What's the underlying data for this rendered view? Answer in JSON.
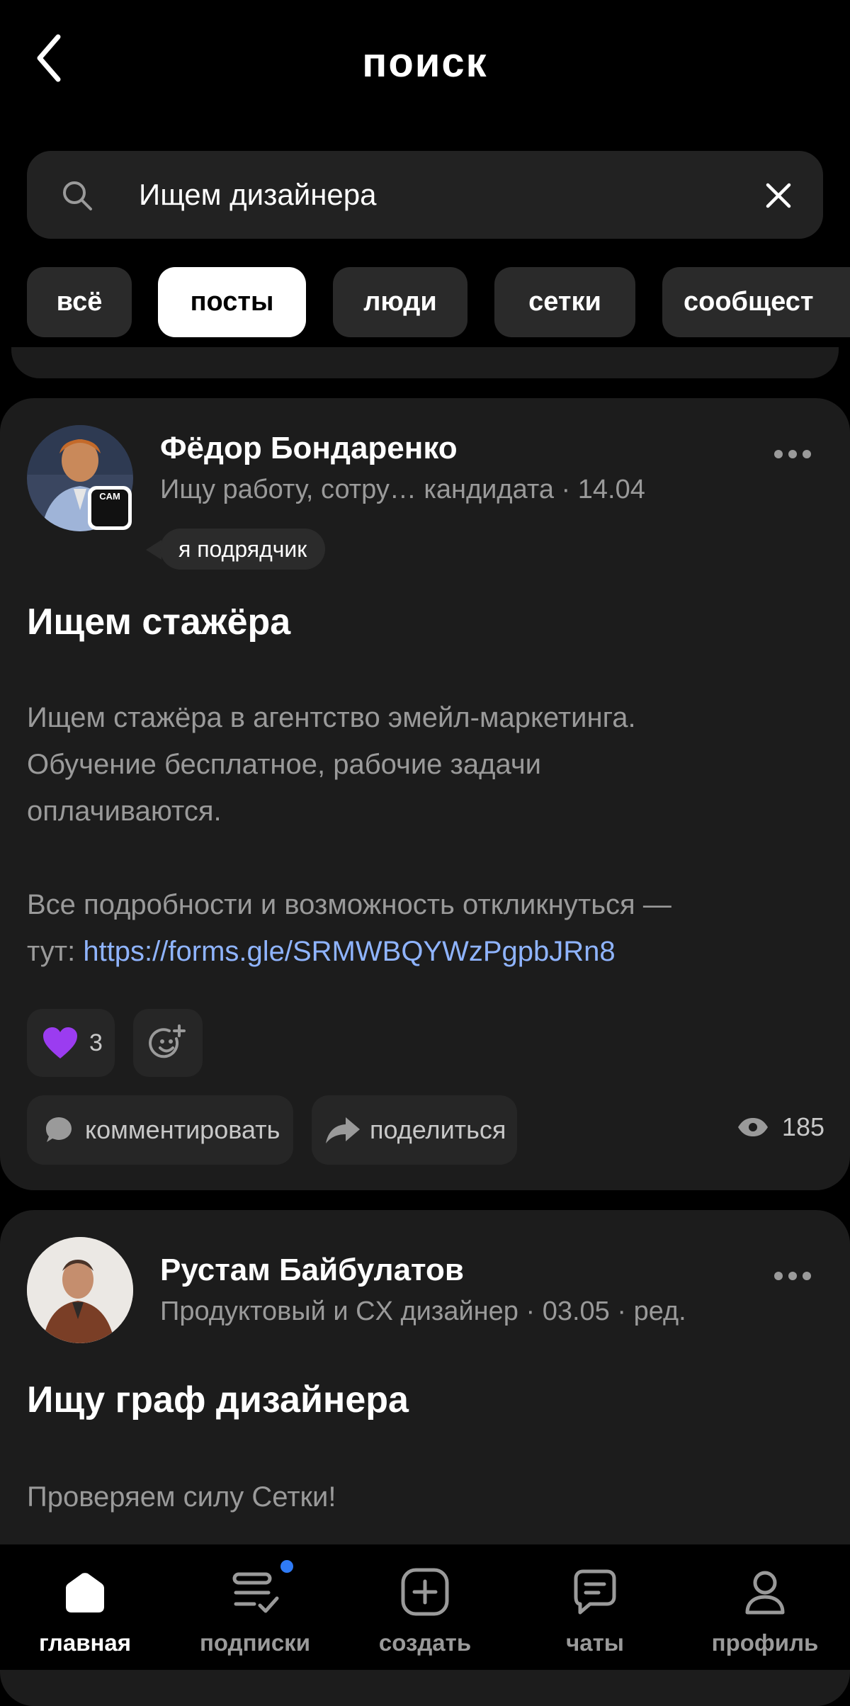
{
  "header": {
    "title": "поиск",
    "back_icon": "chevron-left-icon"
  },
  "search": {
    "value": "Ищем дизайнера",
    "icon": "search-icon",
    "clear_icon": "close-icon"
  },
  "filters": [
    {
      "label": "всё",
      "active": false
    },
    {
      "label": "посты",
      "active": true
    },
    {
      "label": "люди",
      "active": false
    },
    {
      "label": "сетки",
      "active": false
    },
    {
      "label": "сообщест",
      "active": false
    }
  ],
  "posts": [
    {
      "author": "Фёдор Бондаренко",
      "subtitle": "Ищу работу, сотру… кандидата · 14.04",
      "badge": "я подрядчик",
      "avatar_badge": "CAM",
      "title": "Ищем стажёра",
      "body_lines": [
        "Ищем стажёра в агентство эмейл-маркетинга.",
        "Обучение бесплатное, рабочие задачи",
        "оплачиваются."
      ],
      "body_tail_1": "Все подробности и возможность откликнуться —",
      "body_tail_2": "тут: ",
      "link": "https://forms.gle/SRMWBQYWzPgpbJRn8",
      "reaction_count": "3",
      "reaction_icon": "purple-heart-icon",
      "add_reaction_icon": "add-emoji-icon",
      "comment_label": "комментировать",
      "share_label": "поделиться",
      "views": "185"
    },
    {
      "author": "Рустам Байбулатов",
      "subtitle": "Продуктовый и CX дизайнер · 03.05 · ред.",
      "title": "Ищу граф дизайнера",
      "body": "Проверяем силу Сетки!"
    }
  ],
  "tabbar": [
    {
      "label": "главная",
      "icon": "home-icon",
      "active": true
    },
    {
      "label": "подписки",
      "icon": "subscriptions-icon",
      "active": false,
      "has_dot": true
    },
    {
      "label": "создать",
      "icon": "create-icon",
      "active": false
    },
    {
      "label": "чаты",
      "icon": "chat-icon",
      "active": false
    },
    {
      "label": "профиль",
      "icon": "profile-icon",
      "active": false
    }
  ],
  "colors": {
    "accent_link": "#8fb4ff",
    "notification_dot": "#2f7bf6",
    "reaction_heart": "#9b3cf0"
  }
}
